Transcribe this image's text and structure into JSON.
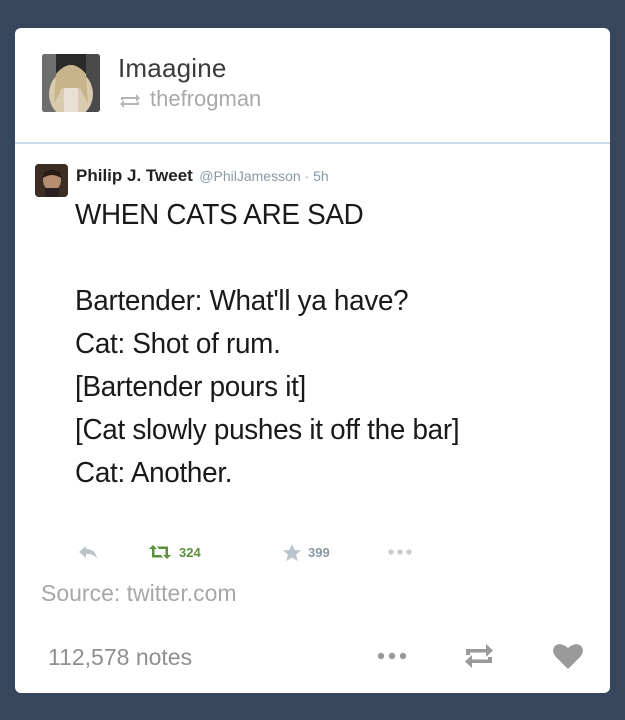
{
  "post": {
    "blog_name": "Imaagine",
    "reblogged_from": "thefrogman"
  },
  "tweet": {
    "name": "Philip J. Tweet",
    "handle": "@PhilJamesson",
    "separator": " · ",
    "time": "5h",
    "title": "WHEN CATS ARE SAD",
    "lines": [
      "Bartender: What'll ya have?",
      "Cat: Shot of rum.",
      "[Bartender pours it]",
      "[Cat slowly pushes it off the bar]",
      "Cat: Another."
    ],
    "retweets": "324",
    "favorites": "399"
  },
  "source_text": "Source: twitter.com",
  "notes": "112,578 notes",
  "icons": {
    "reblog_small": "reblog-icon",
    "reply": "reply-icon",
    "retweet": "retweet-icon",
    "favorite": "star-icon",
    "tweet_more": "more-dots-icon",
    "footer_more": "more-dots-icon",
    "footer_reblog": "reblog-icon",
    "footer_like": "heart-icon"
  },
  "colors": {
    "background": "#36465d",
    "retweet_green": "#5c913b",
    "divider": "#c9dbe8"
  }
}
